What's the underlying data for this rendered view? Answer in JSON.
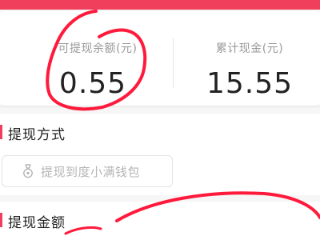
{
  "colors": {
    "accent": "#ef3f5c",
    "label": "#999999",
    "value": "#222222",
    "placeholder": "#b5b5b5",
    "ink": "#ff1a3c"
  },
  "stats": {
    "withdrawable": {
      "label": "可提现余额(元)",
      "value": "0.55"
    },
    "cumulative": {
      "label": "累计现金(元)",
      "value": "15.55"
    }
  },
  "method_section": {
    "title": "提现方式",
    "option": {
      "label": "提现到度小满钱包",
      "icon": "wallet-icon"
    }
  },
  "amount_section": {
    "title": "提现金额"
  }
}
